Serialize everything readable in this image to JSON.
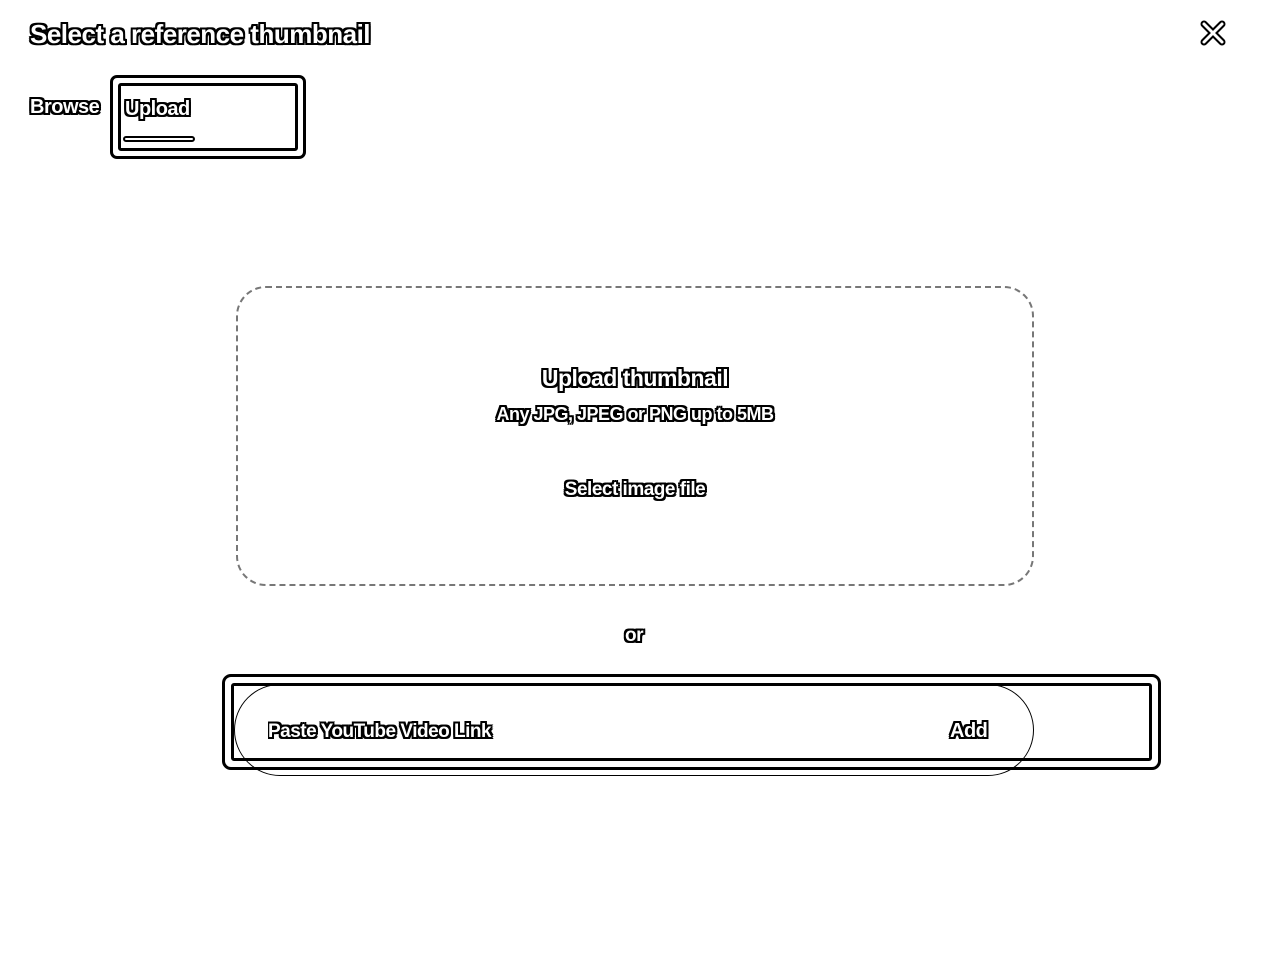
{
  "dialog": {
    "title": "Select a reference thumbnail",
    "close_icon": "close-icon"
  },
  "tabs": [
    {
      "label": "Browse",
      "active": false
    },
    {
      "label": "Upload",
      "active": true
    }
  ],
  "upload": {
    "heading": "Upload thumbnail",
    "hint": "Any JPG, JPEG or PNG up to 5MB",
    "select_button": "Select image file"
  },
  "separator": "or",
  "link": {
    "placeholder": "Paste YouTube Video Link",
    "value": "",
    "add_button": "Add"
  }
}
